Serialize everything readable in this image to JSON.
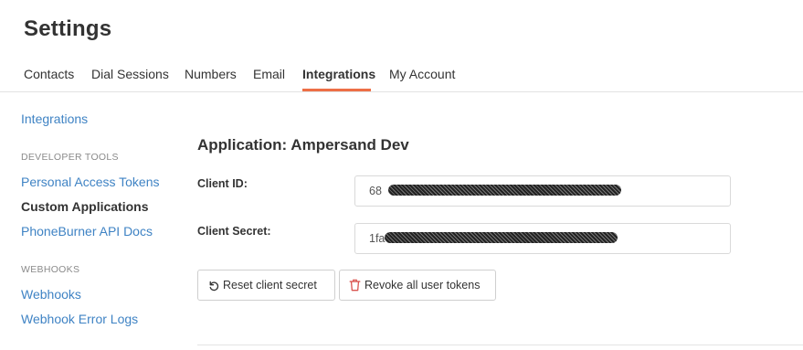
{
  "page": {
    "title": "Settings"
  },
  "tabs": [
    "Contacts",
    "Dial Sessions",
    "Numbers",
    "Email",
    "Integrations",
    "My Account"
  ],
  "active_tab": "Integrations",
  "sidebar": {
    "top_link": "Integrations",
    "developer_heading": "DEVELOPER TOOLS",
    "developer_items": [
      "Personal Access Tokens",
      "Custom Applications",
      "PhoneBurner API Docs"
    ],
    "active_item": "Custom Applications",
    "webhooks_heading": "WEBHOOKS",
    "webhook_items": [
      "Webhooks",
      "Webhook Error Logs"
    ]
  },
  "app": {
    "title": "Application: Ampersand Dev",
    "client_id_label": "Client ID:",
    "client_id_value": "68",
    "client_secret_label": "Client Secret:",
    "client_secret_value": "1fa"
  },
  "buttons": {
    "reset": "Reset client secret",
    "revoke": "Revoke all user tokens"
  },
  "colors": {
    "accent": "#ed6f46",
    "link": "#3f83c4",
    "danger": "#d9534f"
  },
  "icons": {
    "reset": "undo-icon",
    "revoke": "trash-icon"
  }
}
